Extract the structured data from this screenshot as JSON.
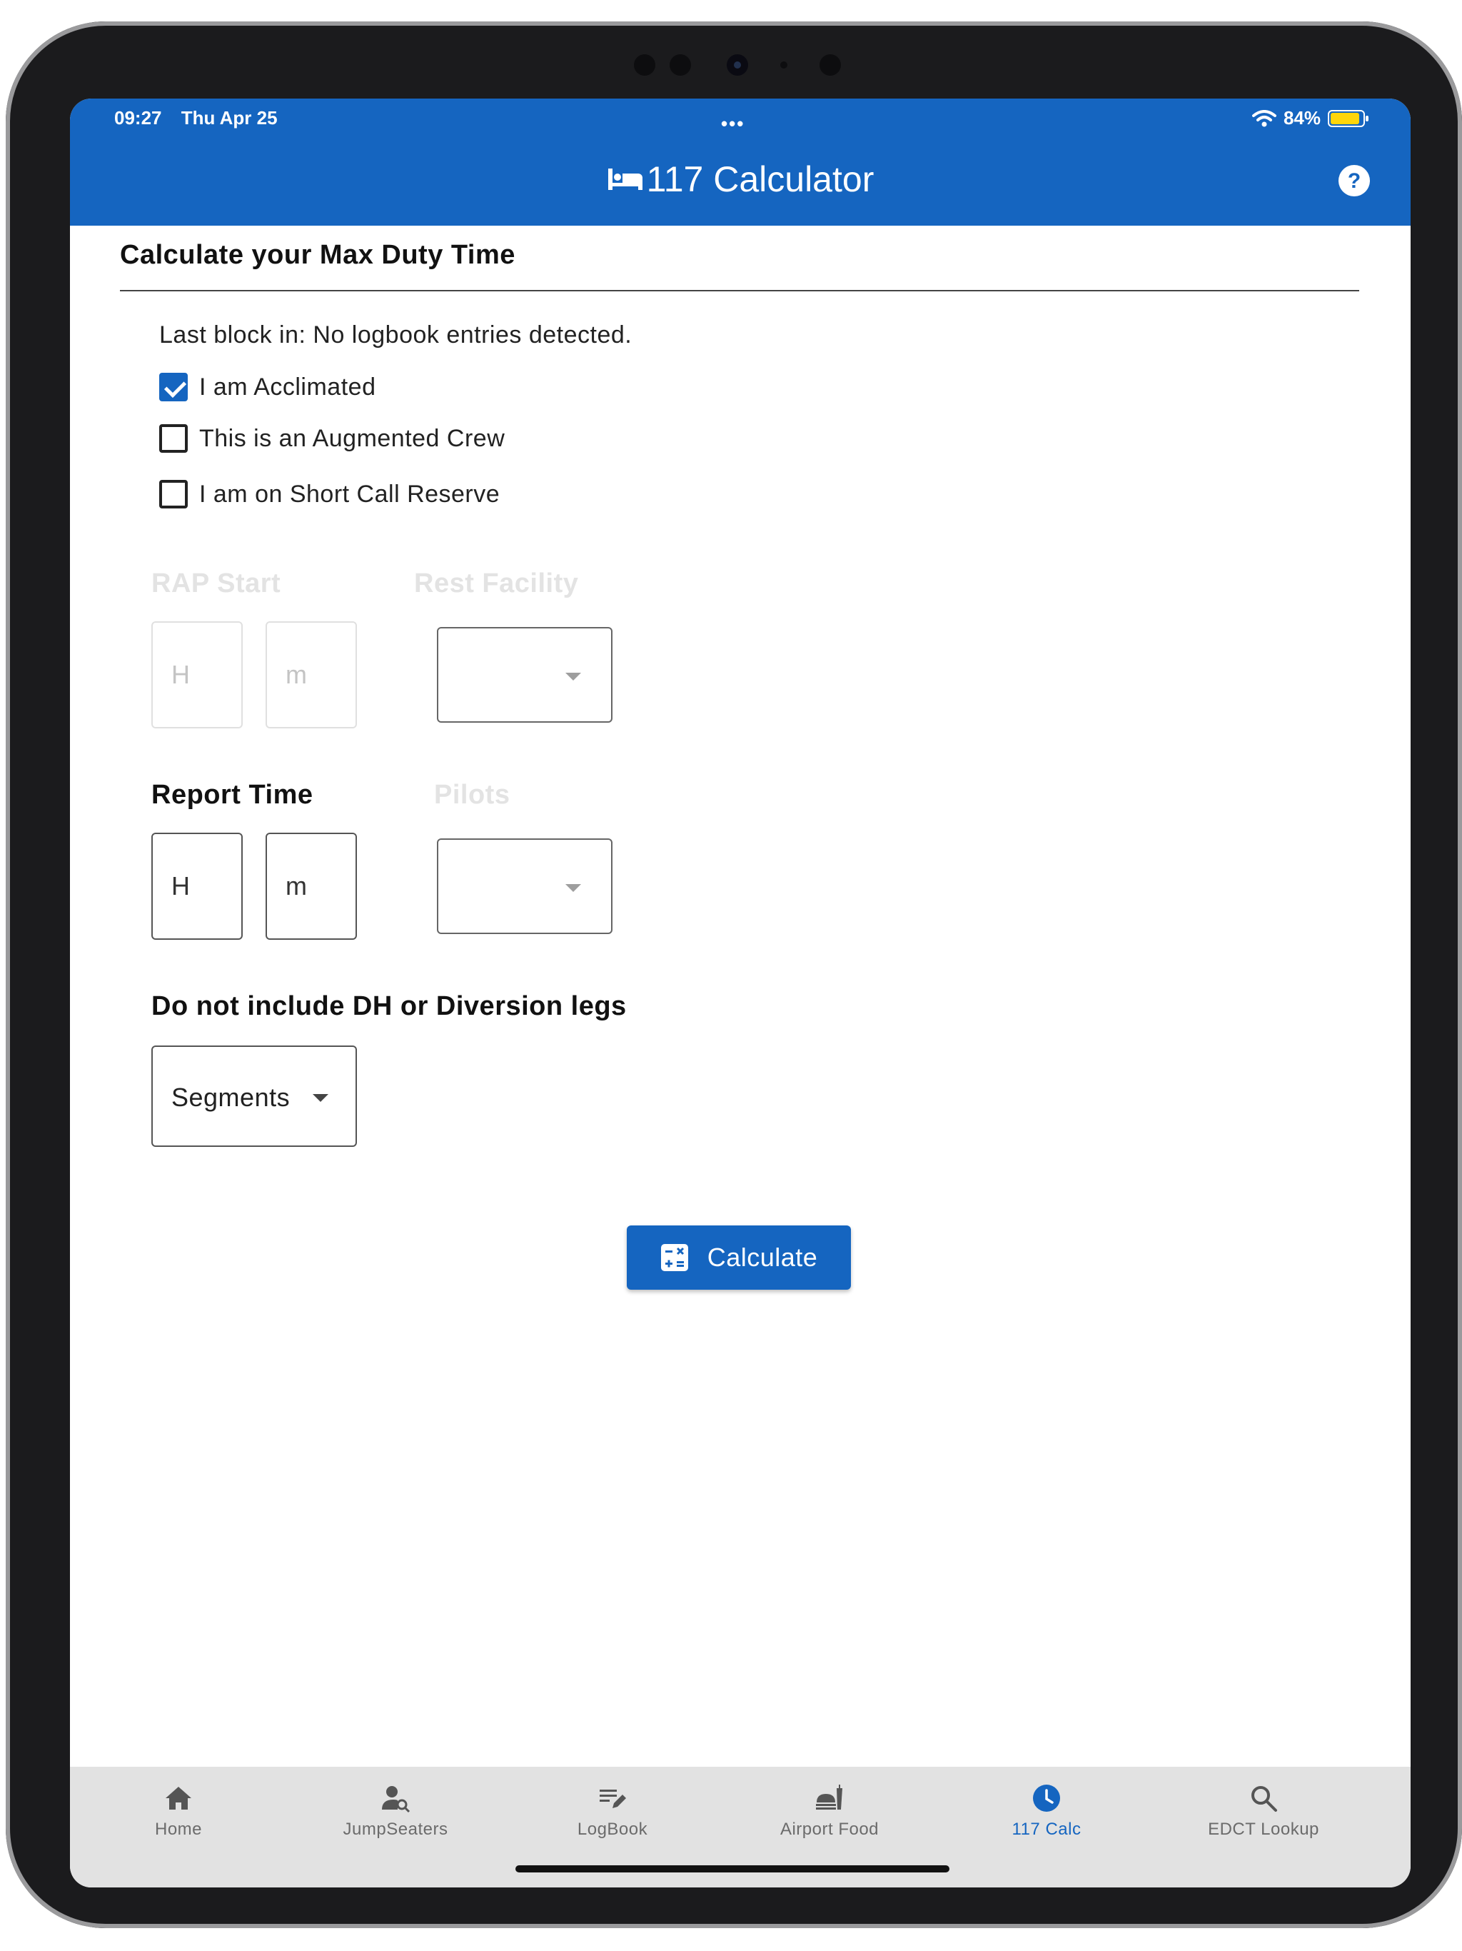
{
  "status_bar": {
    "time": "09:27",
    "date": "Thu Apr 25",
    "dots": "•••",
    "battery": "84%"
  },
  "header": {
    "title": "117 Calculator"
  },
  "section": {
    "title": "Calculate your Max Duty Time"
  },
  "last_block": "Last block in: No logbook entries detected.",
  "checkboxes": [
    {
      "label": "I am Acclimated",
      "checked": true
    },
    {
      "label": "This is an Augmented Crew",
      "checked": false
    },
    {
      "label": "I am on Short Call Reserve",
      "checked": false
    }
  ],
  "rap_start": {
    "label": "RAP Start",
    "hour_placeholder": "H",
    "minute_placeholder": "m"
  },
  "rest_facility": {
    "label": "Rest Facility",
    "value": ""
  },
  "report_time": {
    "label": "Report Time",
    "hour_placeholder": "H",
    "minute_placeholder": "m"
  },
  "pilots": {
    "label": "Pilots",
    "value": ""
  },
  "legs": {
    "label": "Do not include DH or Diversion legs",
    "select_value": "Segments"
  },
  "calculate_button": {
    "label": "Calculate"
  },
  "bottom_nav": [
    {
      "label": "Home",
      "icon": "home-icon"
    },
    {
      "label": "JumpSeaters",
      "icon": "person-search-icon"
    },
    {
      "label": "LogBook",
      "icon": "edit-list-icon"
    },
    {
      "label": "Airport Food",
      "icon": "food-icon"
    },
    {
      "label": "117 Calc",
      "icon": "clock-icon",
      "active": true
    },
    {
      "label": "EDCT Lookup",
      "icon": "search-icon"
    }
  ],
  "colors": {
    "primary": "#1565c0",
    "nav_background": "#e2e2e2",
    "disabled_text": "#e3e3e3"
  }
}
